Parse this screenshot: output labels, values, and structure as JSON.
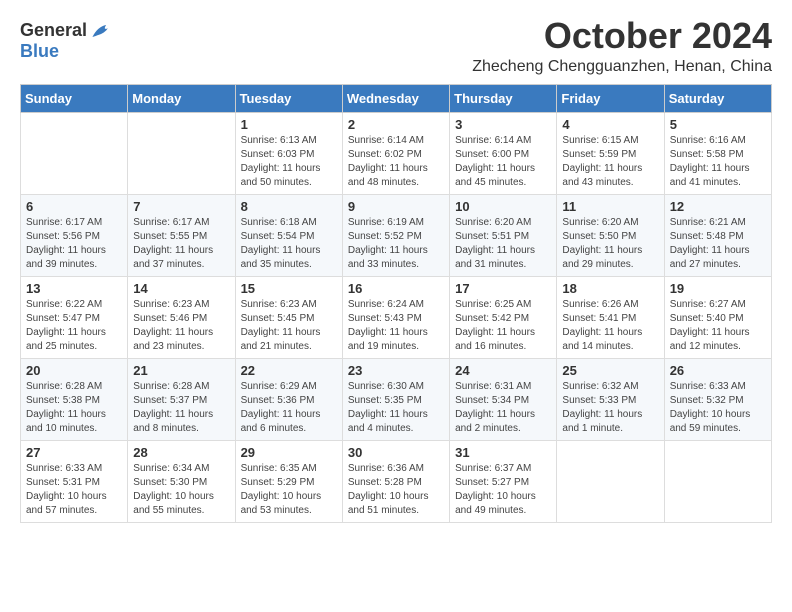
{
  "logo": {
    "general": "General",
    "blue": "Blue"
  },
  "header": {
    "month": "October 2024",
    "location": "Zhecheng Chengguanzhen, Henan, China"
  },
  "days_of_week": [
    "Sunday",
    "Monday",
    "Tuesday",
    "Wednesday",
    "Thursday",
    "Friday",
    "Saturday"
  ],
  "weeks": [
    [
      {
        "day": "",
        "sunrise": "",
        "sunset": "",
        "daylight": ""
      },
      {
        "day": "",
        "sunrise": "",
        "sunset": "",
        "daylight": ""
      },
      {
        "day": "1",
        "sunrise": "Sunrise: 6:13 AM",
        "sunset": "Sunset: 6:03 PM",
        "daylight": "Daylight: 11 hours and 50 minutes."
      },
      {
        "day": "2",
        "sunrise": "Sunrise: 6:14 AM",
        "sunset": "Sunset: 6:02 PM",
        "daylight": "Daylight: 11 hours and 48 minutes."
      },
      {
        "day": "3",
        "sunrise": "Sunrise: 6:14 AM",
        "sunset": "Sunset: 6:00 PM",
        "daylight": "Daylight: 11 hours and 45 minutes."
      },
      {
        "day": "4",
        "sunrise": "Sunrise: 6:15 AM",
        "sunset": "Sunset: 5:59 PM",
        "daylight": "Daylight: 11 hours and 43 minutes."
      },
      {
        "day": "5",
        "sunrise": "Sunrise: 6:16 AM",
        "sunset": "Sunset: 5:58 PM",
        "daylight": "Daylight: 11 hours and 41 minutes."
      }
    ],
    [
      {
        "day": "6",
        "sunrise": "Sunrise: 6:17 AM",
        "sunset": "Sunset: 5:56 PM",
        "daylight": "Daylight: 11 hours and 39 minutes."
      },
      {
        "day": "7",
        "sunrise": "Sunrise: 6:17 AM",
        "sunset": "Sunset: 5:55 PM",
        "daylight": "Daylight: 11 hours and 37 minutes."
      },
      {
        "day": "8",
        "sunrise": "Sunrise: 6:18 AM",
        "sunset": "Sunset: 5:54 PM",
        "daylight": "Daylight: 11 hours and 35 minutes."
      },
      {
        "day": "9",
        "sunrise": "Sunrise: 6:19 AM",
        "sunset": "Sunset: 5:52 PM",
        "daylight": "Daylight: 11 hours and 33 minutes."
      },
      {
        "day": "10",
        "sunrise": "Sunrise: 6:20 AM",
        "sunset": "Sunset: 5:51 PM",
        "daylight": "Daylight: 11 hours and 31 minutes."
      },
      {
        "day": "11",
        "sunrise": "Sunrise: 6:20 AM",
        "sunset": "Sunset: 5:50 PM",
        "daylight": "Daylight: 11 hours and 29 minutes."
      },
      {
        "day": "12",
        "sunrise": "Sunrise: 6:21 AM",
        "sunset": "Sunset: 5:48 PM",
        "daylight": "Daylight: 11 hours and 27 minutes."
      }
    ],
    [
      {
        "day": "13",
        "sunrise": "Sunrise: 6:22 AM",
        "sunset": "Sunset: 5:47 PM",
        "daylight": "Daylight: 11 hours and 25 minutes."
      },
      {
        "day": "14",
        "sunrise": "Sunrise: 6:23 AM",
        "sunset": "Sunset: 5:46 PM",
        "daylight": "Daylight: 11 hours and 23 minutes."
      },
      {
        "day": "15",
        "sunrise": "Sunrise: 6:23 AM",
        "sunset": "Sunset: 5:45 PM",
        "daylight": "Daylight: 11 hours and 21 minutes."
      },
      {
        "day": "16",
        "sunrise": "Sunrise: 6:24 AM",
        "sunset": "Sunset: 5:43 PM",
        "daylight": "Daylight: 11 hours and 19 minutes."
      },
      {
        "day": "17",
        "sunrise": "Sunrise: 6:25 AM",
        "sunset": "Sunset: 5:42 PM",
        "daylight": "Daylight: 11 hours and 16 minutes."
      },
      {
        "day": "18",
        "sunrise": "Sunrise: 6:26 AM",
        "sunset": "Sunset: 5:41 PM",
        "daylight": "Daylight: 11 hours and 14 minutes."
      },
      {
        "day": "19",
        "sunrise": "Sunrise: 6:27 AM",
        "sunset": "Sunset: 5:40 PM",
        "daylight": "Daylight: 11 hours and 12 minutes."
      }
    ],
    [
      {
        "day": "20",
        "sunrise": "Sunrise: 6:28 AM",
        "sunset": "Sunset: 5:38 PM",
        "daylight": "Daylight: 11 hours and 10 minutes."
      },
      {
        "day": "21",
        "sunrise": "Sunrise: 6:28 AM",
        "sunset": "Sunset: 5:37 PM",
        "daylight": "Daylight: 11 hours and 8 minutes."
      },
      {
        "day": "22",
        "sunrise": "Sunrise: 6:29 AM",
        "sunset": "Sunset: 5:36 PM",
        "daylight": "Daylight: 11 hours and 6 minutes."
      },
      {
        "day": "23",
        "sunrise": "Sunrise: 6:30 AM",
        "sunset": "Sunset: 5:35 PM",
        "daylight": "Daylight: 11 hours and 4 minutes."
      },
      {
        "day": "24",
        "sunrise": "Sunrise: 6:31 AM",
        "sunset": "Sunset: 5:34 PM",
        "daylight": "Daylight: 11 hours and 2 minutes."
      },
      {
        "day": "25",
        "sunrise": "Sunrise: 6:32 AM",
        "sunset": "Sunset: 5:33 PM",
        "daylight": "Daylight: 11 hours and 1 minute."
      },
      {
        "day": "26",
        "sunrise": "Sunrise: 6:33 AM",
        "sunset": "Sunset: 5:32 PM",
        "daylight": "Daylight: 10 hours and 59 minutes."
      }
    ],
    [
      {
        "day": "27",
        "sunrise": "Sunrise: 6:33 AM",
        "sunset": "Sunset: 5:31 PM",
        "daylight": "Daylight: 10 hours and 57 minutes."
      },
      {
        "day": "28",
        "sunrise": "Sunrise: 6:34 AM",
        "sunset": "Sunset: 5:30 PM",
        "daylight": "Daylight: 10 hours and 55 minutes."
      },
      {
        "day": "29",
        "sunrise": "Sunrise: 6:35 AM",
        "sunset": "Sunset: 5:29 PM",
        "daylight": "Daylight: 10 hours and 53 minutes."
      },
      {
        "day": "30",
        "sunrise": "Sunrise: 6:36 AM",
        "sunset": "Sunset: 5:28 PM",
        "daylight": "Daylight: 10 hours and 51 minutes."
      },
      {
        "day": "31",
        "sunrise": "Sunrise: 6:37 AM",
        "sunset": "Sunset: 5:27 PM",
        "daylight": "Daylight: 10 hours and 49 minutes."
      },
      {
        "day": "",
        "sunrise": "",
        "sunset": "",
        "daylight": ""
      },
      {
        "day": "",
        "sunrise": "",
        "sunset": "",
        "daylight": ""
      }
    ]
  ]
}
